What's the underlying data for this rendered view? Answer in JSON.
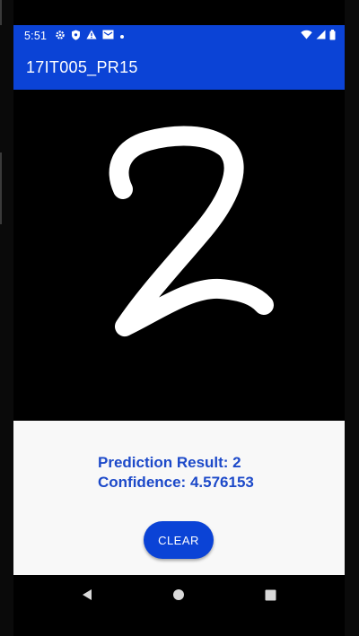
{
  "status_bar": {
    "time": "5:51",
    "left_icons": [
      "gear-icon",
      "shield-icon",
      "warning-icon",
      "mail-icon",
      "dot-icon"
    ],
    "right_icons": [
      "wifi-icon",
      "signal-icon",
      "battery-icon"
    ]
  },
  "app_bar": {
    "title": "17IT005_PR15",
    "color": "#0b43d6"
  },
  "canvas": {
    "background": "#000000",
    "stroke_color": "#ffffff",
    "drawn_digit": "handwritten 2"
  },
  "result": {
    "prediction_label": "Prediction Result: 2",
    "confidence_label": "Confidence: 4.576153",
    "text_color": "#1c49c9"
  },
  "actions": {
    "clear_label": "CLEAR"
  },
  "nav_bar": {
    "buttons": [
      "back-icon",
      "home-icon",
      "recents-icon"
    ]
  }
}
